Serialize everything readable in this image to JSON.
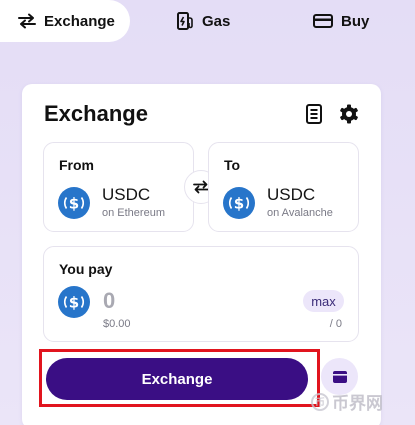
{
  "tabs": [
    {
      "label": "Exchange",
      "icon": "swap-arrows-icon",
      "active": true
    },
    {
      "label": "Gas",
      "icon": "gas-pump-icon",
      "active": false
    },
    {
      "label": "Buy",
      "icon": "credit-card-icon",
      "active": false
    }
  ],
  "card": {
    "title": "Exchange",
    "header_icons": [
      "receipt-icon",
      "gear-icon"
    ]
  },
  "from": {
    "label": "From",
    "token": "USDC",
    "chain": "on Ethereum",
    "icon": "usdc-coin-icon"
  },
  "to": {
    "label": "To",
    "token": "USDC",
    "chain": "on Avalanche",
    "icon": "usdc-coin-icon"
  },
  "pay": {
    "label": "You pay",
    "amount": "0",
    "usd_value": "$0.00",
    "max_label": "max",
    "balance": "/ 0"
  },
  "action": {
    "exchange_label": "Exchange"
  },
  "watermark": {
    "text": "币界网"
  },
  "colors": {
    "background": "#e4ddf6",
    "accent": "#3a0e84",
    "usdc": "#2775ca",
    "pill": "#ece6fa",
    "highlight": "#e1141e"
  }
}
